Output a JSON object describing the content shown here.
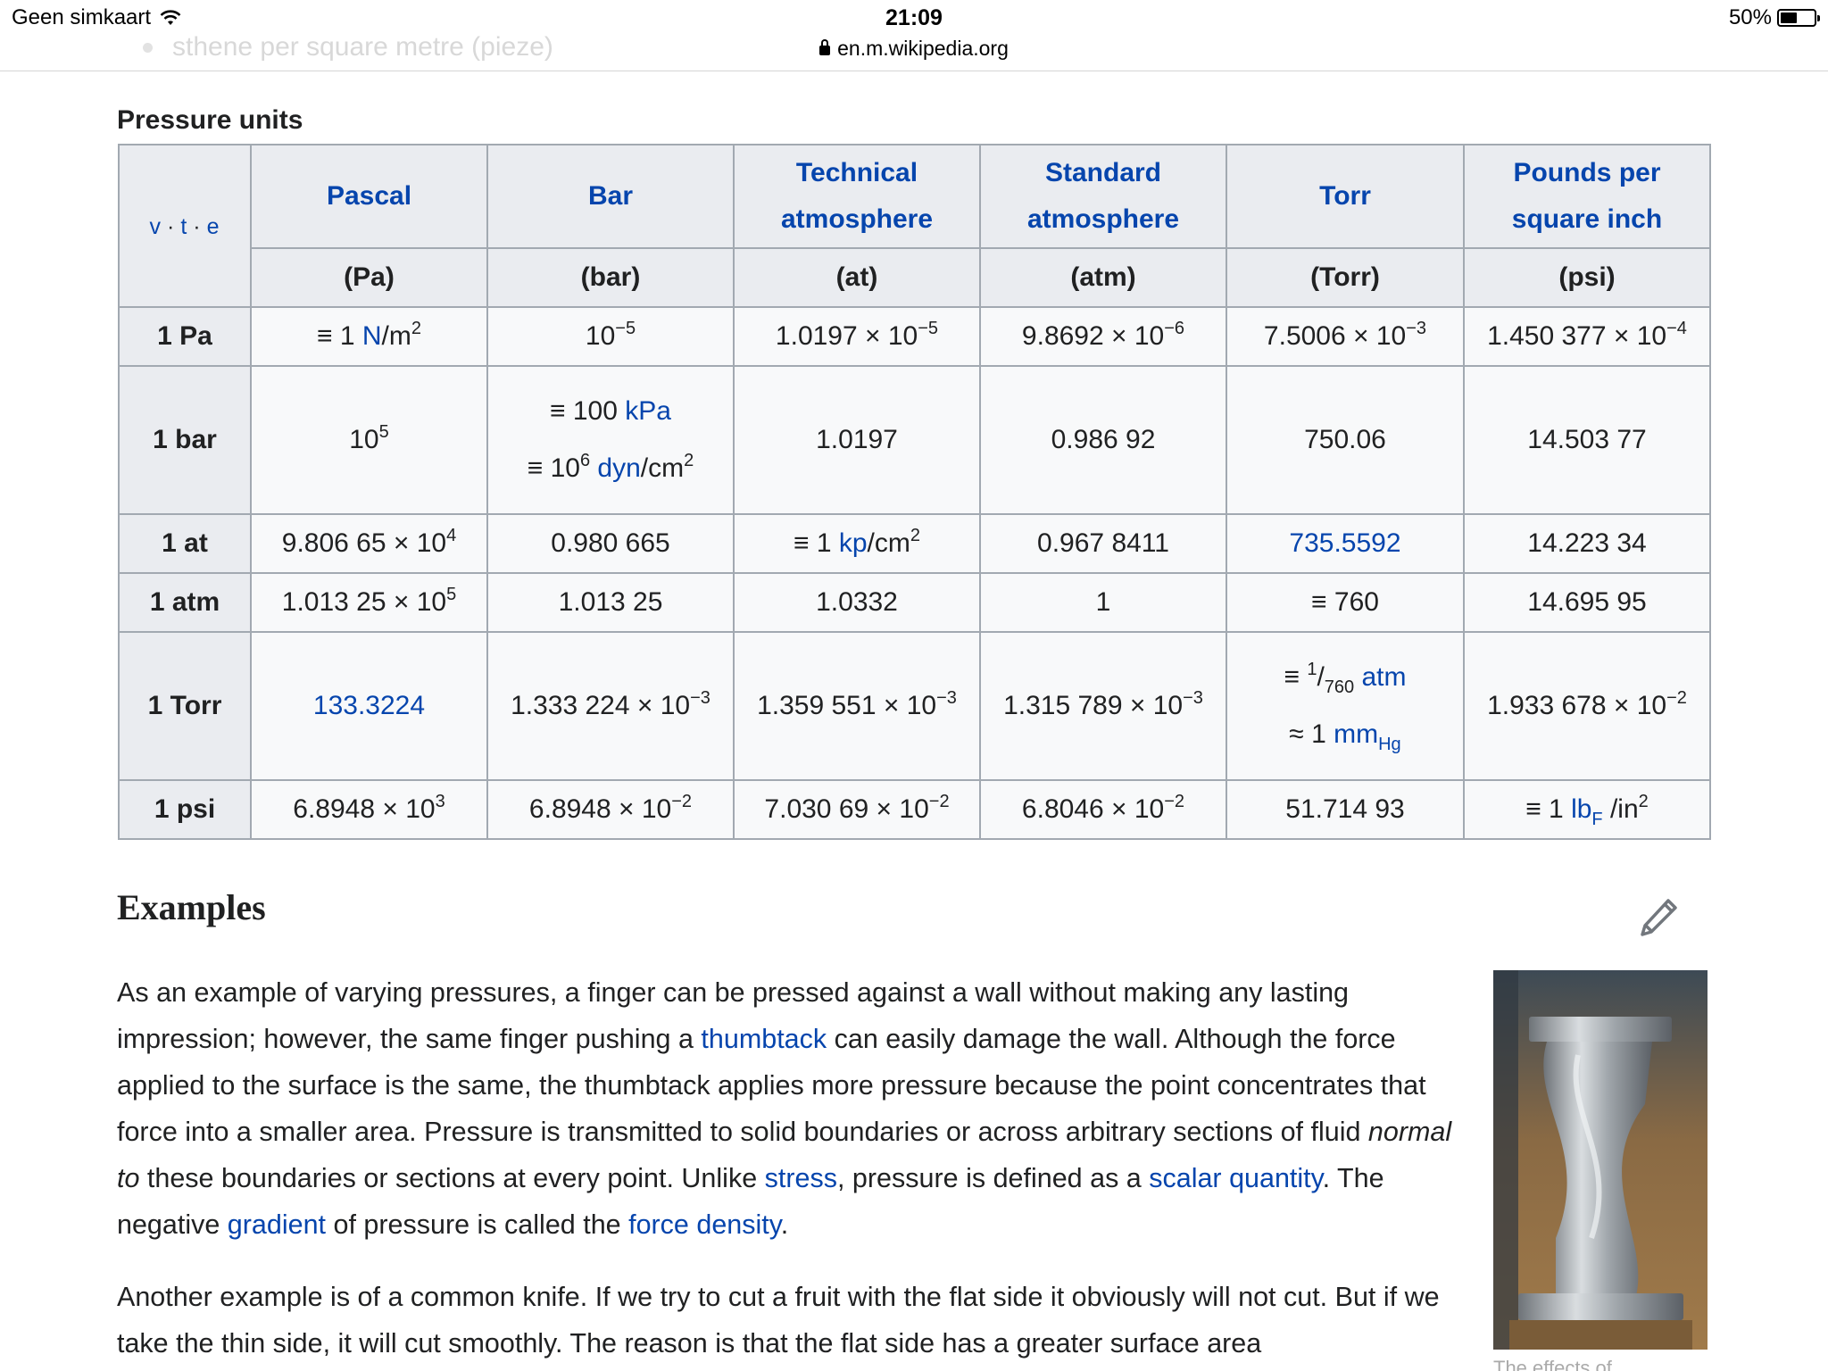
{
  "status_bar": {
    "carrier": "Geen simkaart",
    "time": "21:09",
    "url": "en.m.wikipedia.org",
    "battery_percent": "50%",
    "battery_level": 0.5,
    "ghost_text": "sthene per square metre (pieze)"
  },
  "table": {
    "caption": "Pressure units",
    "navbar": {
      "v": "v",
      "t": "t",
      "e": "e"
    },
    "headers": [
      {
        "line1": "Pascal",
        "line2": "",
        "symbol": "(Pa)"
      },
      {
        "line1": "Bar",
        "line2": "",
        "symbol": "(bar)"
      },
      {
        "line1": "Technical",
        "line2": "atmosphere",
        "symbol": "(at)"
      },
      {
        "line1": "Standard",
        "line2": "atmosphere",
        "symbol": "(atm)"
      },
      {
        "line1": "Torr",
        "line2": "",
        "symbol": "(Torr)"
      },
      {
        "line1": "Pounds per",
        "line2": "square inch",
        "symbol": "(psi)"
      }
    ],
    "rows": {
      "pa": {
        "label": "1 Pa",
        "pascal": {
          "pre": "≡ 1 ",
          "link": "N",
          "post": "/m",
          "sup": "2"
        },
        "bar": {
          "base": "10",
          "exp": "−5"
        },
        "at": {
          "mant": "1.0197 × 10",
          "exp": "−5"
        },
        "atm": {
          "mant": "9.8692 × 10",
          "exp": "−6"
        },
        "torr": {
          "mant": "7.5006 × 10",
          "exp": "−3"
        },
        "psi": {
          "mant": "1.450 377 × 10",
          "exp": "−4"
        }
      },
      "bar": {
        "label": "1 bar",
        "pascal": {
          "base": "10",
          "exp": "5"
        },
        "bar_line1": {
          "pre": "≡ 100 ",
          "link": "kPa"
        },
        "bar_line2": {
          "pre": "≡ 10",
          "exp": "6",
          "link": "dyn",
          "post": "/cm",
          "sup": "2"
        },
        "at": "1.0197",
        "atm": "0.986 92",
        "torr": "750.06",
        "psi": "14.503 77"
      },
      "at": {
        "label": "1 at",
        "pascal": {
          "mant": "9.806 65 × 10",
          "exp": "4"
        },
        "bar": "0.980 665",
        "at": {
          "pre": "≡ 1 ",
          "link": "kp",
          "post": "/cm",
          "sup": "2"
        },
        "atm": "0.967 8411",
        "torr": "735.5592",
        "psi": "14.223 34"
      },
      "atm": {
        "label": "1 atm",
        "pascal": {
          "mant": "1.013 25 × 10",
          "exp": "5"
        },
        "bar": "1.013 25",
        "at": "1.0332",
        "atm": "1",
        "torr": "≡ 760",
        "psi": "14.695 95"
      },
      "torr": {
        "label": "1 Torr",
        "pascal": "133.3224",
        "bar": {
          "mant": "1.333 224 × 10",
          "exp": "−3"
        },
        "at": {
          "mant": "1.359 551 × 10",
          "exp": "−3"
        },
        "atm": {
          "mant": "1.315 789 × 10",
          "exp": "−3"
        },
        "torr_line1": {
          "pre": "≡ ",
          "num": "1",
          "den": "760",
          "link": "atm"
        },
        "torr_line2": {
          "pre": "≈ 1 ",
          "link": "mm",
          "sub": "Hg"
        },
        "psi": {
          "mant": "1.933 678 × 10",
          "exp": "−2"
        }
      },
      "psi": {
        "label": "1 psi",
        "pascal": {
          "mant": "6.8948 × 10",
          "exp": "3"
        },
        "bar": {
          "mant": "6.8948 × 10",
          "exp": "−2"
        },
        "at": {
          "mant": "7.030 69 × 10",
          "exp": "−2"
        },
        "atm": {
          "mant": "6.8046 × 10",
          "exp": "−2"
        },
        "torr": "51.714 93",
        "psi": {
          "pre": "≡ 1 ",
          "link": "lb",
          "sub": "F",
          "post": " /in",
          "sup": "2"
        }
      }
    }
  },
  "examples": {
    "title": "Examples",
    "para1": {
      "t1": "As an example of varying pressures, a finger can be pressed against a wall without making any lasting impression; however, the same finger pushing a ",
      "l1": "thumbtack",
      "t2": " can easily damage the wall. Although the force applied to the surface is the same, the thumbtack applies more pressure because the point concentrates that force into a smaller area. Pressure is transmitted to solid boundaries or across arbitrary sections of fluid ",
      "i1": "normal to",
      "t3": " these boundaries or sections at every point. Unlike ",
      "l2": "stress",
      "t4": ", pressure is defined as a ",
      "l3": "scalar quantity",
      "t5": ". The negative ",
      "l4": "gradient",
      "t6": " of pressure is called the ",
      "l5": "force density",
      "t7": "."
    },
    "para2": "Another example is of a common knife. If we try to cut a fruit with the flat side it obviously will not cut. But if we take the thin side, it will cut smoothly. The reason is that the flat side has a greater surface area",
    "figure_caption": "The effects of"
  },
  "colors": {
    "link": "#0645ad",
    "header_bg": "#eaecf0",
    "cell_bg": "#f8f9fa",
    "border": "#a2a9b1",
    "text": "#202122"
  }
}
